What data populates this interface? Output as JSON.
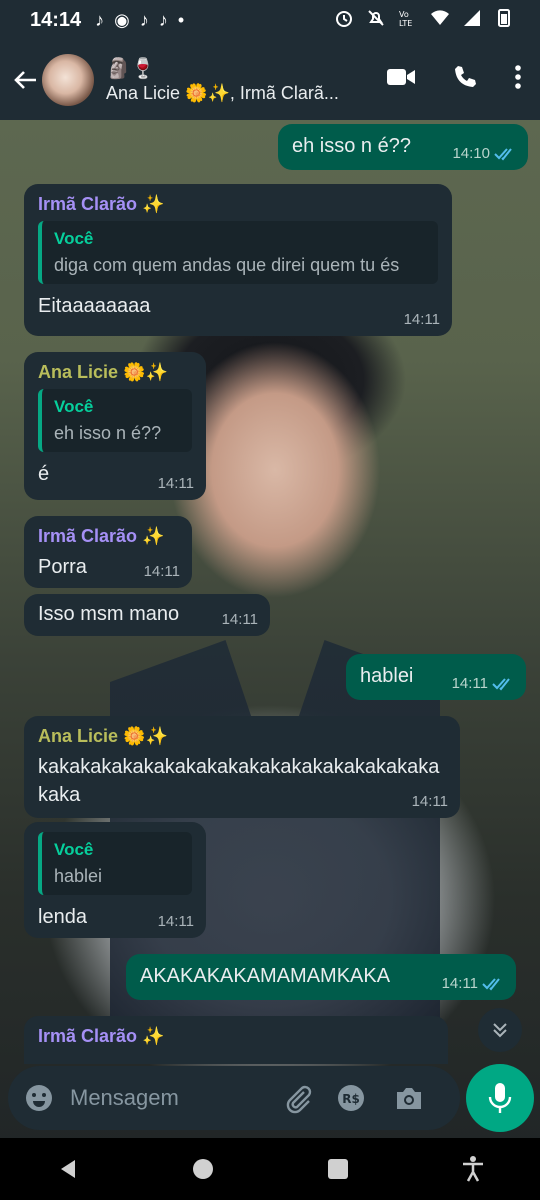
{
  "status": {
    "time": "14:14"
  },
  "header": {
    "emojis": "🗿🍷",
    "title": "Ana Licie 🌼✨, Irmã Clarã..."
  },
  "messages": [
    {
      "dir": "out",
      "text": "eh isso n é??",
      "time": "14:10",
      "read": true
    },
    {
      "dir": "in",
      "sender": "Irmã Clarão ✨",
      "quote_author": "Você",
      "quote_text": "diga com quem andas que direi quem tu és",
      "text": "Eitaaaaaaaa",
      "time": "14:11"
    },
    {
      "dir": "in",
      "sender": "Ana Licie 🌼✨",
      "quote_author": "Você",
      "quote_text": "eh isso n é??",
      "text": "é",
      "time": "14:11"
    },
    {
      "dir": "in",
      "sender": "Irmã Clarão ✨",
      "text": "Porra",
      "time": "14:11"
    },
    {
      "dir": "in",
      "text": "Isso msm mano",
      "time": "14:11"
    },
    {
      "dir": "out",
      "text": "hablei",
      "time": "14:11",
      "read": true
    },
    {
      "dir": "in",
      "sender": "Ana Licie 🌼✨",
      "text": "kakakakakakakakakakakakakakakakakakakakaka",
      "time": "14:11"
    },
    {
      "dir": "in",
      "quote_author": "Você",
      "quote_text": "hablei",
      "text": "lenda",
      "time": "14:11"
    },
    {
      "dir": "out",
      "text": "AKAKAKAKAMAMAMKAKA",
      "time": "14:11",
      "read": true
    },
    {
      "dir": "in",
      "sender": "Irmã Clarão ✨",
      "text": ""
    }
  ],
  "input": {
    "placeholder": "Mensagem"
  }
}
